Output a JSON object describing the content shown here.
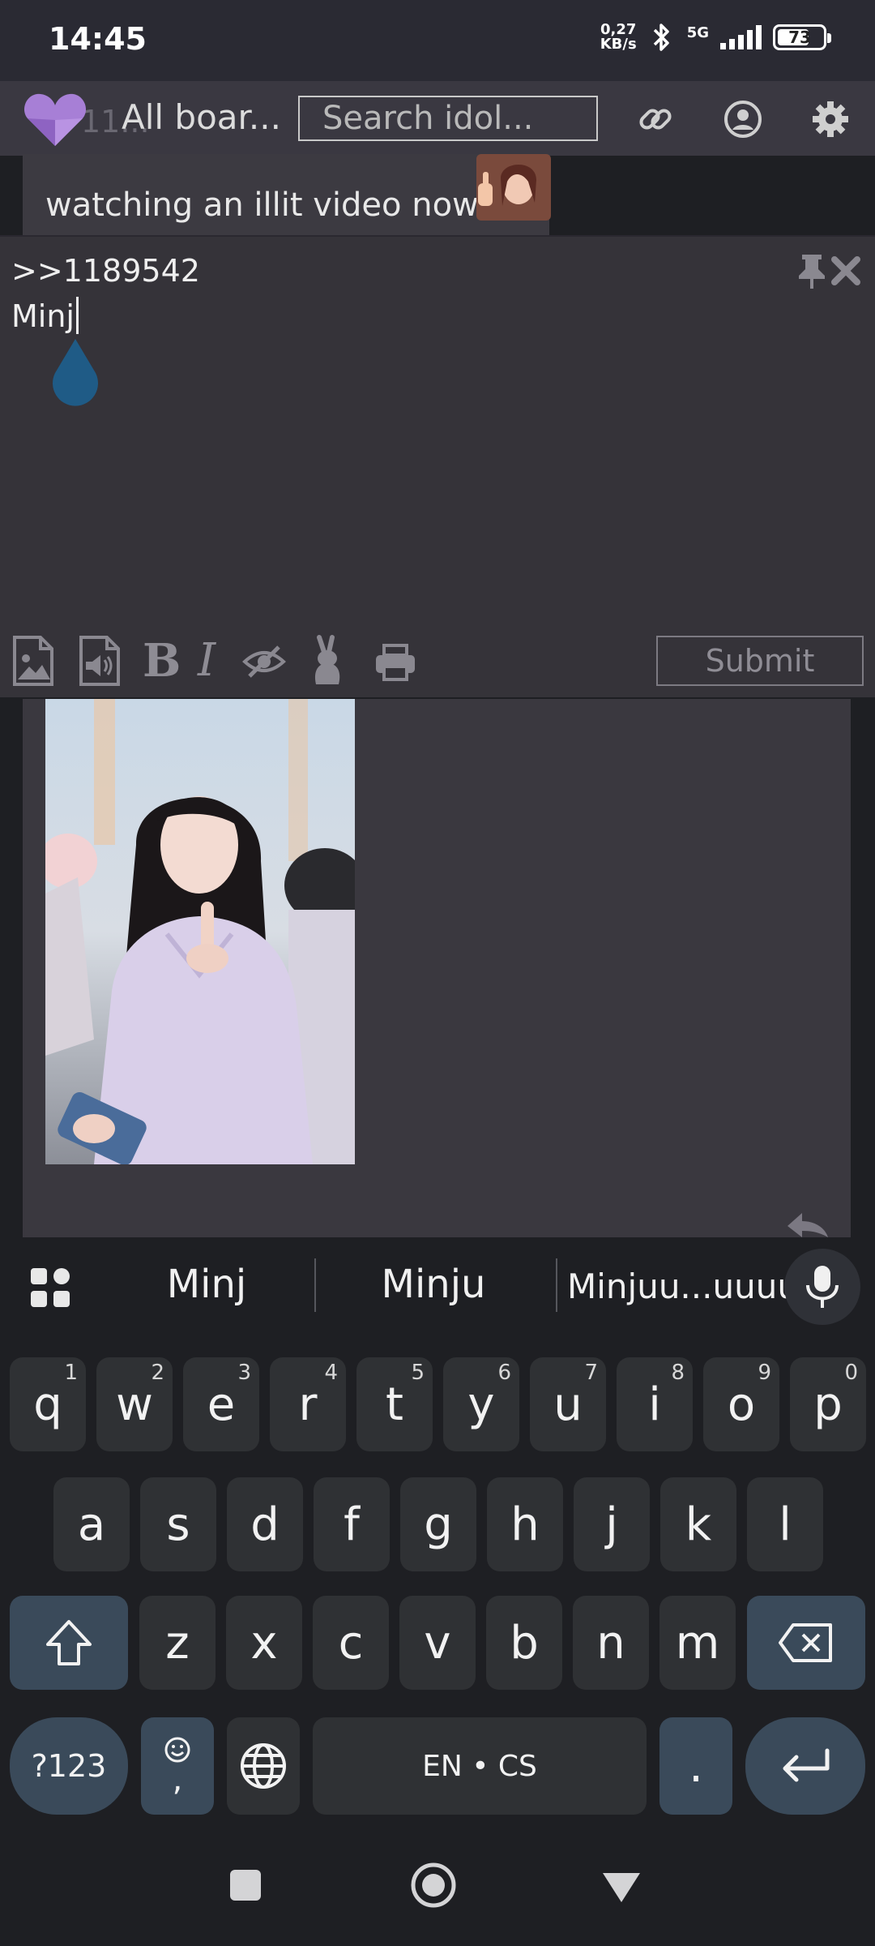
{
  "status_bar": {
    "time": "14:45",
    "net_speed_top": "0,27",
    "net_speed_bottom": "KB/s",
    "network": "5G",
    "battery": "73",
    "battery_level": 0.73
  },
  "nav": {
    "ghost_text": "11...",
    "boards_label": "All boar...",
    "search_placeholder": "Search idol..."
  },
  "post_preview": {
    "text": "watching an illit video now"
  },
  "composer": {
    "reply_ref": ">>1189542",
    "typed_text": "Minj",
    "submit_label": "Submit"
  },
  "keyboard": {
    "suggestions": [
      "Minj",
      "Minju",
      "Minjuu...uuuu"
    ],
    "row1": [
      {
        "k": "q",
        "h": "1"
      },
      {
        "k": "w",
        "h": "2"
      },
      {
        "k": "e",
        "h": "3"
      },
      {
        "k": "r",
        "h": "4"
      },
      {
        "k": "t",
        "h": "5"
      },
      {
        "k": "y",
        "h": "6"
      },
      {
        "k": "u",
        "h": "7"
      },
      {
        "k": "i",
        "h": "8"
      },
      {
        "k": "o",
        "h": "9"
      },
      {
        "k": "p",
        "h": "0"
      }
    ],
    "row2": [
      "a",
      "s",
      "d",
      "f",
      "g",
      "h",
      "j",
      "k",
      "l"
    ],
    "row3": [
      "z",
      "x",
      "c",
      "v",
      "b",
      "n",
      "m"
    ],
    "symbols_label": "?123",
    "emoji_comma": ",",
    "space_label": "EN • CS",
    "period": "."
  },
  "colors": {
    "accent_purple": "#a77fd6",
    "keyboard_mod": "#3a4a5a"
  }
}
